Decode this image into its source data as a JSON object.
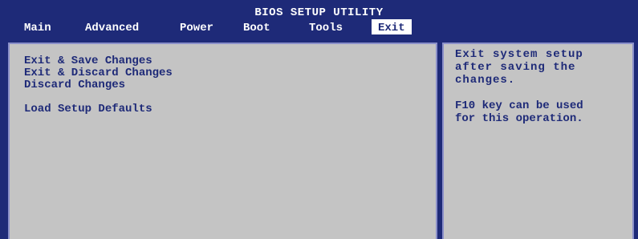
{
  "header": {
    "title": "BIOS SETUP UTILITY",
    "tabs": [
      {
        "label": "Main"
      },
      {
        "label": "Advanced"
      },
      {
        "label": "Power"
      },
      {
        "label": "Boot"
      },
      {
        "label": "Tools"
      },
      {
        "label": "Exit",
        "active": true
      }
    ]
  },
  "menu": {
    "items": [
      {
        "label": "Exit & Save Changes"
      },
      {
        "label": "Exit & Discard Changes"
      },
      {
        "label": "Discard Changes"
      },
      {
        "label": "Load Setup Defaults"
      }
    ]
  },
  "help": {
    "description": "Exit system setup\nafter saving the\nchanges.",
    "note": "F10 key can be used\nfor this operation."
  },
  "colors": {
    "frame_blue": "#1e2a78",
    "panel_gray": "#c4c4c4",
    "border_lavender": "#8a8fc9",
    "text_white": "#ffffff"
  }
}
